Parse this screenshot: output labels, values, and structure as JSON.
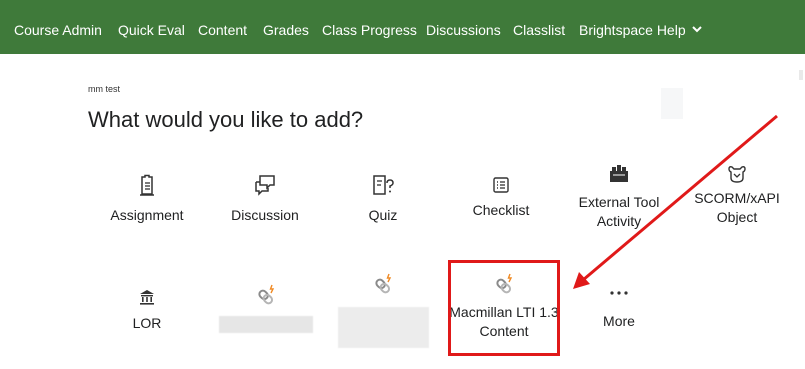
{
  "nav": {
    "items": [
      {
        "label": "Course Admin"
      },
      {
        "label": "Quick Eval"
      },
      {
        "label": "Content"
      },
      {
        "label": "Grades"
      },
      {
        "label": "Class Progress"
      },
      {
        "label": "Discussions"
      },
      {
        "label": "Classlist"
      },
      {
        "label": "Brightspace Help"
      }
    ],
    "bg_color": "#3f7a3a"
  },
  "context_label": "mm test",
  "title": "What would you like to add?",
  "tiles": {
    "assignment": {
      "label": "Assignment",
      "icon": "assignment-icon"
    },
    "discussion": {
      "label": "Discussion",
      "icon": "discussion-icon"
    },
    "quiz": {
      "label": "Quiz",
      "icon": "quiz-icon"
    },
    "checklist": {
      "label": "Checklist",
      "icon": "checklist-icon"
    },
    "external_tool": {
      "label": "External Tool Activity",
      "icon": "lego-icon"
    },
    "scorm": {
      "label": "SCORM/xAPI Object",
      "icon": "scorm-icon"
    },
    "lor": {
      "label": "LOR",
      "icon": "library-icon"
    },
    "lti_blurred_1": {
      "label": "",
      "icon": "lti-link-icon"
    },
    "lti_blurred_2": {
      "label": "",
      "icon": "lti-link-icon"
    },
    "macmillan": {
      "label": "Macmillan LTI 1.3 Content",
      "icon": "lti-link-icon"
    },
    "more": {
      "label": "More",
      "icon": "ellipsis-icon"
    }
  },
  "annotation": {
    "color": "#e01919"
  }
}
